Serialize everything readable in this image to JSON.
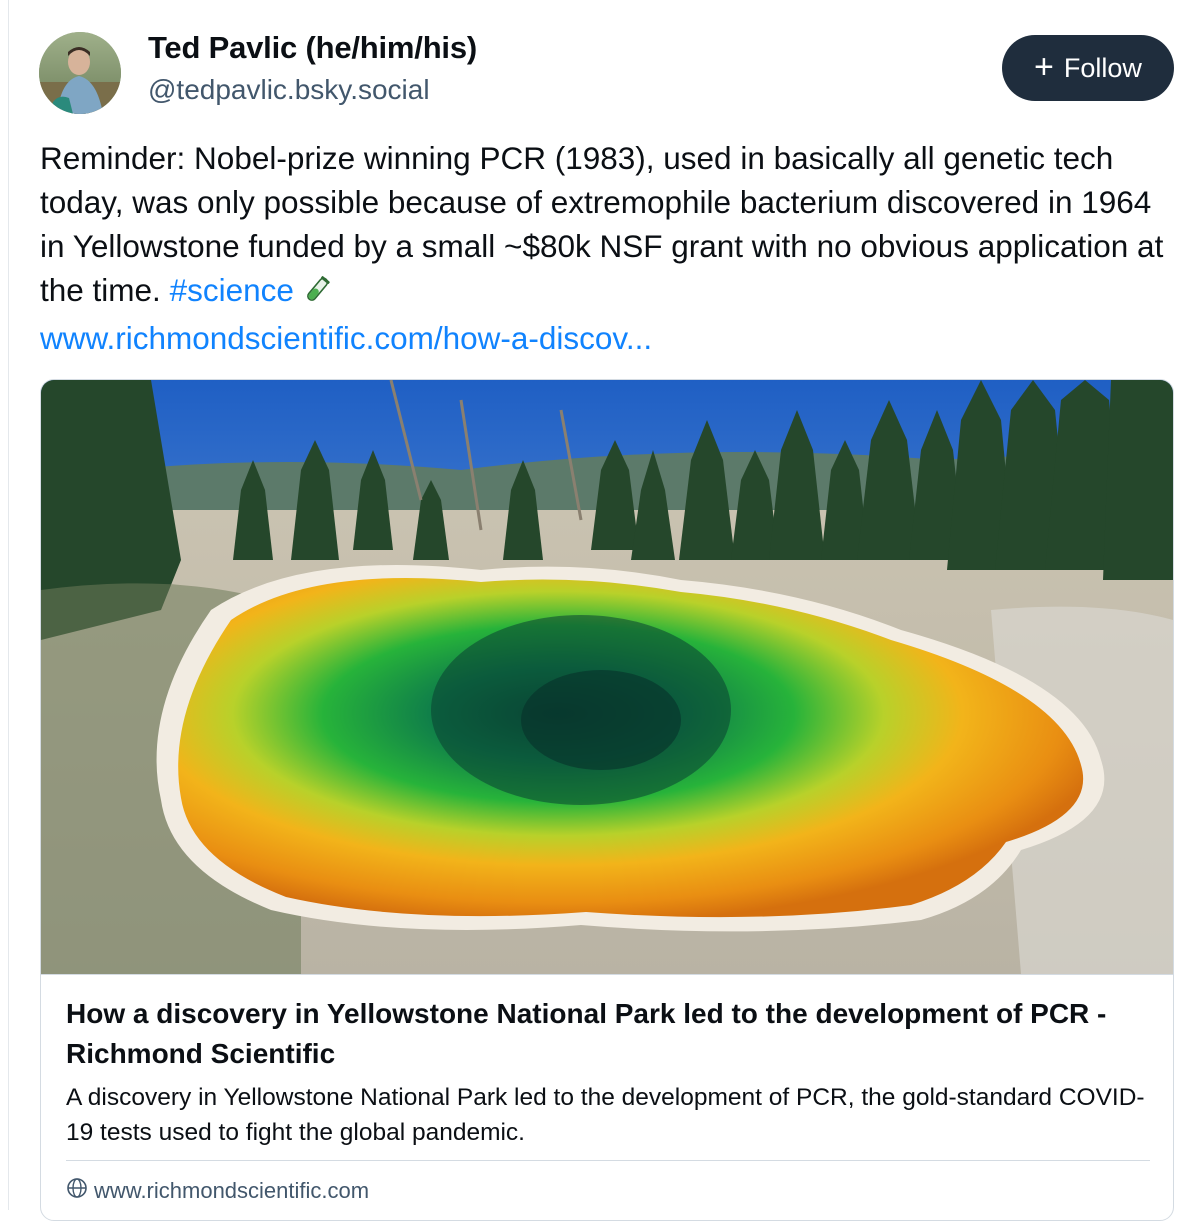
{
  "author": {
    "display_name": "Ted Pavlic (he/him/his)",
    "handle": "@tedpavlic.bsky.social",
    "avatar_icon": "profile-photo"
  },
  "follow_button": {
    "label": "Follow",
    "icon": "plus-icon"
  },
  "post": {
    "text": "Reminder: Nobel-prize winning PCR (1983), used in basically all genetic tech today, was only possible because of extremophile bacterium discovered in 1964 in Yellowstone funded by a small ~$80k NSF grant with no obvious application at the time. ",
    "hashtag": "#science",
    "emoji_icon": "test-tube-icon",
    "link": "www.richmondscientific.com/how-a-discov..."
  },
  "link_card": {
    "image": "yellowstone-hot-spring-photo",
    "title": "How a discovery in Yellowstone National Park led to the development of PCR - Richmond Scientific",
    "description": "A discovery in Yellowstone National Park led to the development of PCR, the gold-standard COVID-19 tests used to fight the global pandemic.",
    "domain": "www.richmondscientific.com",
    "domain_icon": "globe-icon"
  },
  "colors": {
    "link": "#1083fe",
    "follow_bg": "#1f2d3d",
    "muted": "#42576c",
    "border": "#d4dbe2"
  }
}
